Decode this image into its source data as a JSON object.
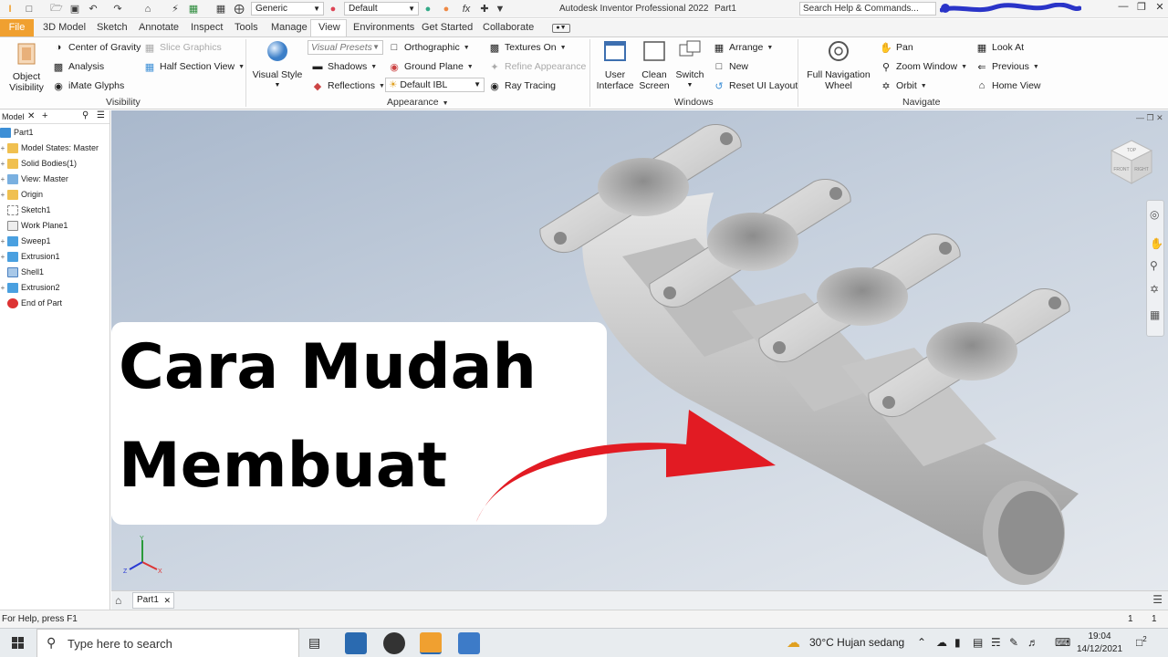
{
  "titlebar": {
    "visual_style_dropdown": "Generic",
    "appearance_dropdown": "Default",
    "app_title": "Autodesk Inventor Professional 2022",
    "doc_title": "Part1",
    "search_placeholder": "Search Help & Commands..."
  },
  "tabs": [
    "File",
    "3D Model",
    "Sketch",
    "Annotate",
    "Inspect",
    "Tools",
    "Manage",
    "View",
    "Environments",
    "Get Started",
    "Collaborate"
  ],
  "ribbon": {
    "visibility": {
      "object_visibility": [
        "Object",
        "Visibility"
      ],
      "center_of_gravity": "Center of Gravity",
      "slice_graphics": "Slice Graphics",
      "analysis": "Analysis",
      "half_section_view": "Half Section View",
      "imate_glyphs": "iMate Glyphs",
      "label": "Visibility"
    },
    "appearance": {
      "visual_style": [
        "Visual Style"
      ],
      "visual_presets": "Visual Presets",
      "orthographic": "Orthographic",
      "textures_on": "Textures On",
      "shadows": "Shadows",
      "ground_plane": "Ground Plane",
      "refine_appearance": "Refine Appearance",
      "reflections": "Reflections",
      "ibl": "Default IBL",
      "ray_tracing": "Ray Tracing",
      "label": "Appearance"
    },
    "windows": {
      "user_interface": [
        "User",
        "Interface"
      ],
      "clean_screen": [
        "Clean",
        "Screen"
      ],
      "switch": [
        "Switch"
      ],
      "arrange": "Arrange",
      "new": "New",
      "reset_ui_layout": "Reset UI Layout",
      "label": "Windows"
    },
    "navigate": {
      "full_nav_wheel": [
        "Full Navigation",
        "Wheel"
      ],
      "pan": "Pan",
      "zoom_window": "Zoom Window",
      "orbit": "Orbit",
      "look_at": "Look At",
      "previous": "Previous",
      "home_view": "Home View",
      "label": "Navigate"
    }
  },
  "browser": {
    "tab_label": "Model",
    "items": [
      {
        "label": "Part1",
        "color": "#3d8fd6"
      },
      {
        "label": "Model States: Master",
        "color": "#f0b030"
      },
      {
        "label": "Solid Bodies(1)",
        "color": "#f0b030"
      },
      {
        "label": "View: Master",
        "color": "#3d8fd6"
      },
      {
        "label": "Origin",
        "color": "#f0b030"
      },
      {
        "label": "Sketch1",
        "color": "#9aa6b2"
      },
      {
        "label": "Work Plane1",
        "color": "#9aa6b2"
      },
      {
        "label": "Sweep1",
        "color": "#3d8fd6"
      },
      {
        "label": "Extrusion1",
        "color": "#3d8fd6"
      },
      {
        "label": "Shell1",
        "color": "#3d8fd6"
      },
      {
        "label": "Extrusion2",
        "color": "#3d8fd6"
      },
      {
        "label": "End of Part",
        "color": "#d33"
      }
    ]
  },
  "overlay": {
    "line1": "Cara Mudah",
    "line2": "Membuat",
    "arrow_color": "#e21b23"
  },
  "viewcube": {
    "top": "TOP",
    "front": "FRONT",
    "right": "RIGHT"
  },
  "triad": {
    "x": "X",
    "y": "Y",
    "z": "Z"
  },
  "doctab": {
    "label": "Part1"
  },
  "status": {
    "help": "For Help, press F1",
    "count1": "1",
    "count2": "1"
  },
  "taskbar": {
    "search_placeholder": "Type here to search",
    "weather": "30°C  Hujan sedang",
    "time": "19:04",
    "date": "14/12/2021",
    "notifications": "2"
  }
}
